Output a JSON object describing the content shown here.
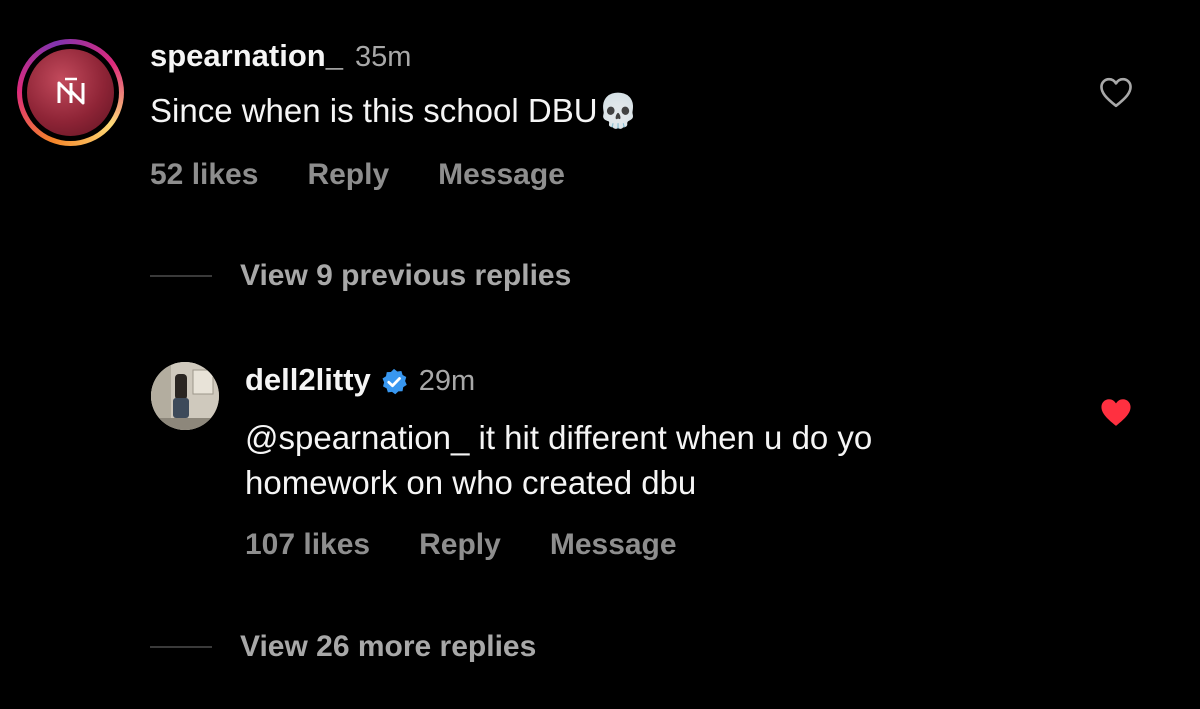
{
  "comment1": {
    "username": "spearnation_",
    "time": "35m",
    "text": "Since when is this school DBU",
    "emoji": "💀",
    "likes": "52 likes",
    "reply": "Reply",
    "message": "Message",
    "liked": false
  },
  "view_previous": "View 9 previous replies",
  "comment2": {
    "username": "dell2litty",
    "verified": true,
    "time": "29m",
    "text_line1": "@spearnation_ it hit different when u do yo",
    "text_line2": "homework on who created dbu",
    "likes": "107 likes",
    "reply": "Reply",
    "message": "Message",
    "liked": true
  },
  "view_more": "View 26 more replies",
  "colors": {
    "background": "#000000",
    "like_red": "#ff3040",
    "verified_blue": "#3897f0",
    "muted": "#8e8e8e"
  },
  "icons": [
    "story-ring",
    "heart-outline-icon",
    "heart-filled-icon",
    "verified-badge-icon"
  ]
}
